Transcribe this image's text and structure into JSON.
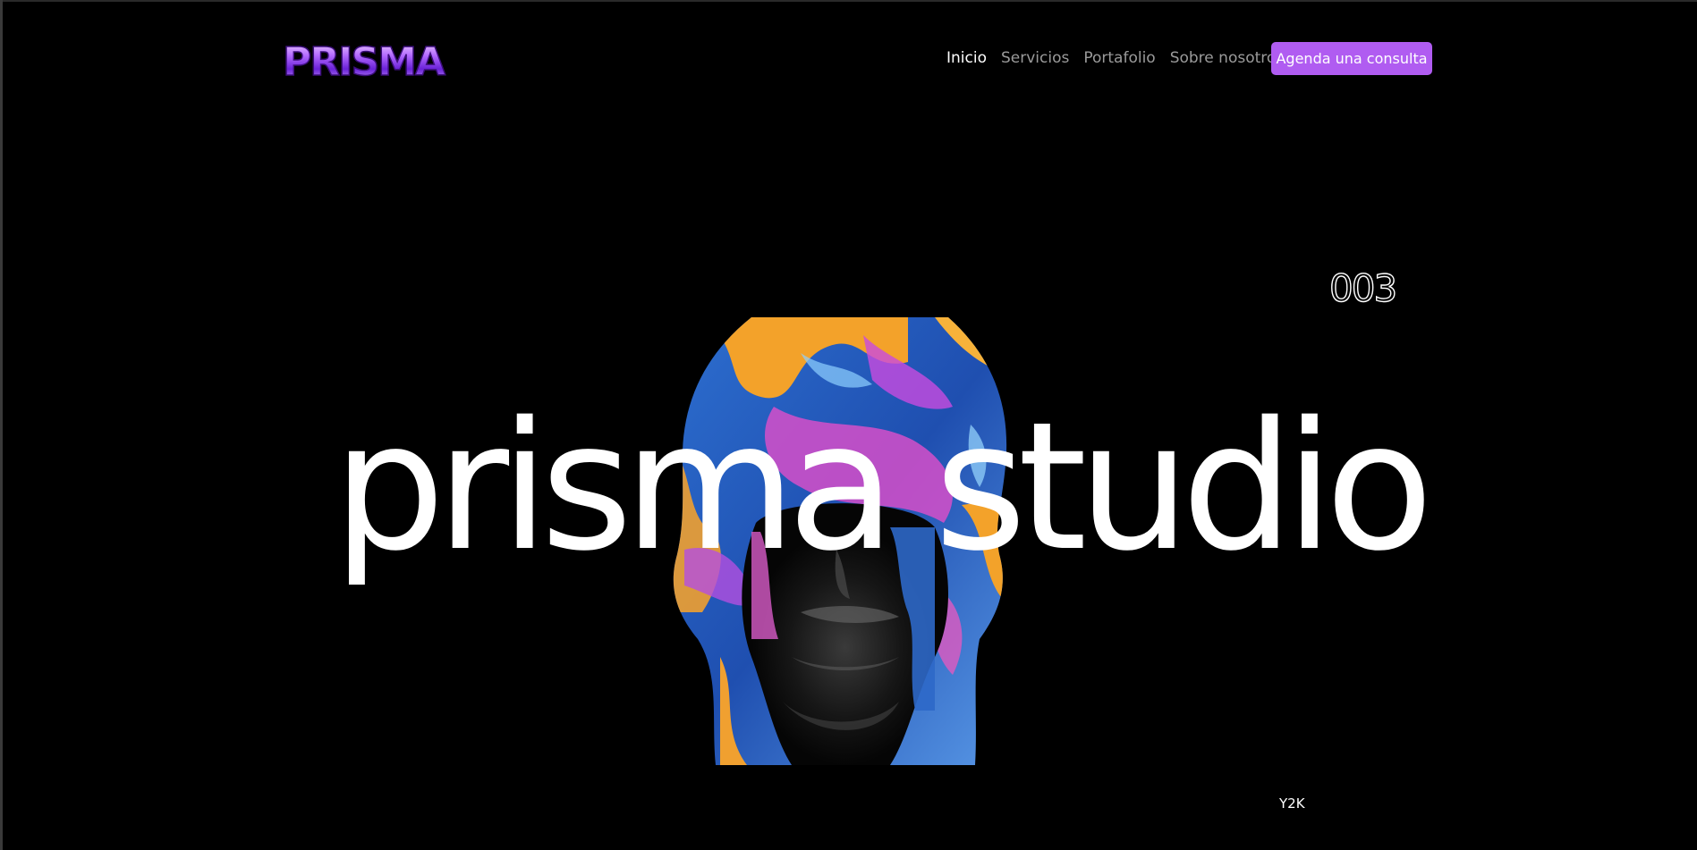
{
  "brand": {
    "logo_text": "PRISMA",
    "accent": "#b05cf1"
  },
  "nav": {
    "items": [
      {
        "label": "Inicio",
        "active": true
      },
      {
        "label": "Servicios",
        "active": false
      },
      {
        "label": "Portafolio",
        "active": false
      },
      {
        "label": "Sobre nosotros",
        "active": false
      }
    ],
    "cta_label": "Agenda una consulta"
  },
  "hero": {
    "counter": "003",
    "title": "prisma studio",
    "tag": "Y2K",
    "image_icon": "liquid-chrome-head-sculpture"
  }
}
